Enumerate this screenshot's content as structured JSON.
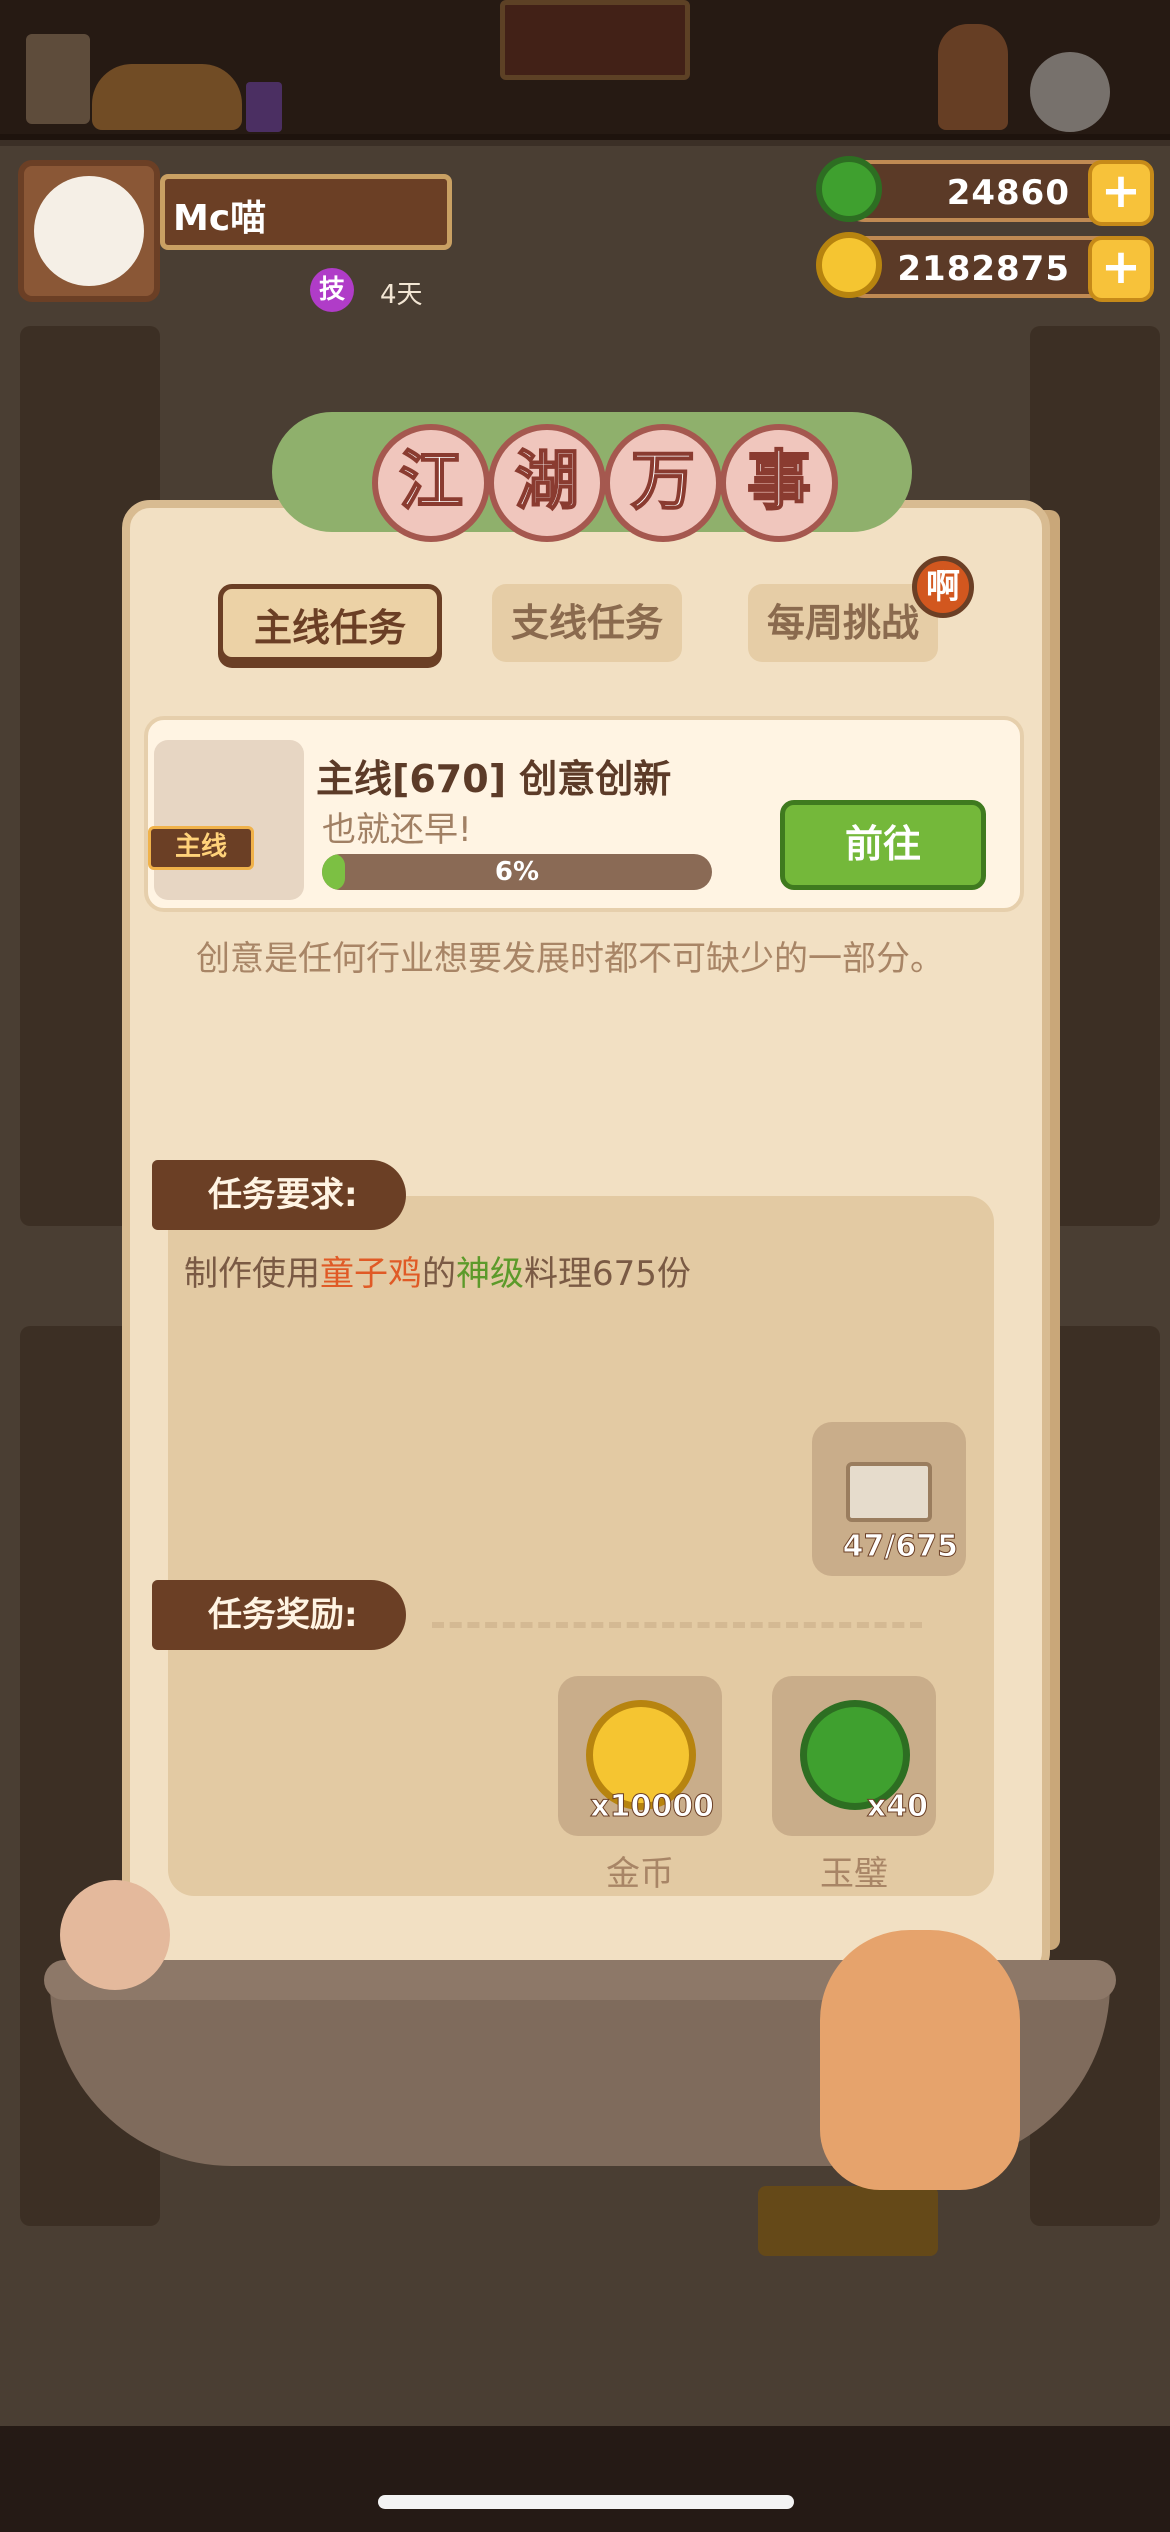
{
  "player": {
    "name": "Mc喵",
    "skill_badge": "技",
    "days": "4天"
  },
  "currencies": [
    {
      "icon": "jade-bi-icon",
      "value": "24860",
      "add": "+"
    },
    {
      "icon": "gold-coin-icon",
      "value": "2182875",
      "add": "+"
    }
  ],
  "panel": {
    "title_chars": [
      "江",
      "湖",
      "万",
      "事"
    ],
    "tabs": [
      {
        "label": "主线任务",
        "active": true
      },
      {
        "label": "支线任务",
        "active": false
      },
      {
        "label": "每周挑战",
        "active": false
      }
    ],
    "tab_notice": "啊",
    "quest": {
      "tag": "主线",
      "title": "主线[670] 创意创新",
      "subtitle": "也就还早!",
      "progress_percent": 6,
      "progress_label": "6%",
      "go_label": "前往"
    },
    "description": "创意是任何行业想要发展时都不可缺少的一部分。",
    "requirement": {
      "header": "任务要求:",
      "text_before": "制作使用",
      "ingredient": "童子鸡",
      "text_mid": "的",
      "grade": "神级",
      "text_after": "料理675份",
      "item_count": "47/675"
    },
    "rewards": {
      "header": "任务奖励:",
      "items": [
        {
          "icon": "gold-coin-icon",
          "count": "x10000",
          "name": "金币"
        },
        {
          "icon": "jade-bi-icon",
          "count": "x40",
          "name": "玉璧"
        }
      ]
    }
  },
  "colors": {
    "accent_green": "#74b83a",
    "frame_brown": "#6b3f25",
    "parchment": "#f2e0c3"
  }
}
